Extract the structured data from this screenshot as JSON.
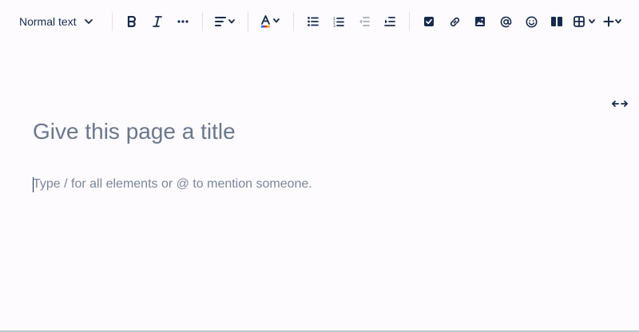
{
  "toolbar": {
    "text_style": "Normal text",
    "icons": [
      "bold-icon",
      "italic-icon",
      "more-formatting-icon",
      "align-icon",
      "text-color-icon",
      "bullet-list-icon",
      "numbered-list-icon",
      "outdent-icon",
      "indent-icon",
      "action-item-icon",
      "link-icon",
      "image-icon",
      "mention-icon",
      "emoji-icon",
      "layouts-icon",
      "table-icon",
      "insert-plus-icon"
    ],
    "colors": {
      "text_color_underline": "#de350b",
      "accent": "#172b4d"
    }
  },
  "editor": {
    "title_placeholder": "Give this page a title",
    "body_placeholder": "Type / for all elements or @ to mention someone."
  }
}
